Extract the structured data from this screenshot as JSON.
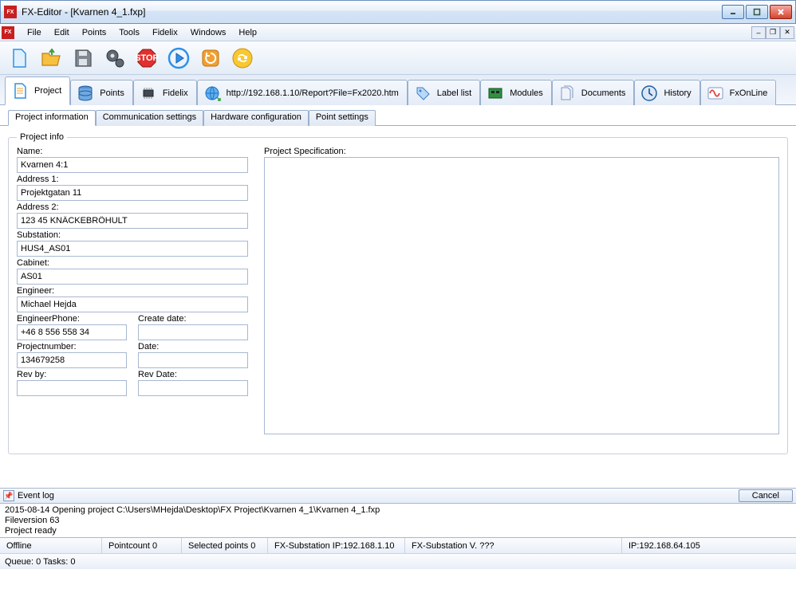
{
  "window": {
    "title": "FX-Editor - [Kvarnen 4_1.fxp]"
  },
  "menu": {
    "items": [
      "File",
      "Edit",
      "Points",
      "Tools",
      "Fidelix",
      "Windows",
      "Help"
    ]
  },
  "bigtabs": {
    "items": [
      {
        "label": "Project",
        "icon": "document"
      },
      {
        "label": "Points",
        "icon": "database"
      },
      {
        "label": "Fidelix",
        "icon": "chip"
      },
      {
        "label": "http://192.168.1.10/Report?File=Fx2020.htm",
        "icon": "globe"
      },
      {
        "label": "Label list",
        "icon": "tag"
      },
      {
        "label": "Modules",
        "icon": "board"
      },
      {
        "label": "Documents",
        "icon": "docs"
      },
      {
        "label": "History",
        "icon": "clock"
      },
      {
        "label": "FxOnLine",
        "icon": "wave"
      }
    ]
  },
  "subtabs": {
    "items": [
      "Project information",
      "Communication settings",
      "Hardware configuration",
      "Point settings"
    ]
  },
  "fieldset_legend": "Project info",
  "labels": {
    "name": "Name:",
    "address1": "Address 1:",
    "address2": "Address 2:",
    "substation": "Substation:",
    "cabinet": "Cabinet:",
    "engineer": "Engineer:",
    "engineerphone": "EngineerPhone:",
    "createdate": "Create date:",
    "projectnumber": "Projectnumber:",
    "date": "Date:",
    "revby": "Rev by:",
    "revdate": "Rev Date:",
    "projectspec": "Project Specification:"
  },
  "values": {
    "name": "Kvarnen 4:1",
    "address1": "Projektgatan 11",
    "address2": "123 45 KNÄCKEBRÖHULT",
    "substation": "HUS4_AS01",
    "cabinet": "AS01",
    "engineer": "Michael Hejda",
    "engineerphone": "+46 8 556 558 34",
    "createdate": "",
    "projectnumber": "134679258",
    "date": "",
    "revby": "",
    "revdate": "",
    "projectspec": ""
  },
  "eventlog": {
    "title": "Event log",
    "cancel": "Cancel",
    "lines": [
      "2015-08-14 Opening project C:\\Users\\MHejda\\Desktop\\FX Project\\Kvarnen 4_1\\Kvarnen 4_1.fxp",
      "Fileversion 63",
      "Project ready"
    ]
  },
  "status": {
    "offline": "Offline",
    "pointcount": "Pointcount 0",
    "selected": "Selected points 0",
    "subip": "FX-Substation IP:192.168.1.10",
    "subv": "FX-Substation V. ???",
    "ip": "IP:192.168.64.105",
    "queue": "Queue: 0 Tasks: 0"
  }
}
